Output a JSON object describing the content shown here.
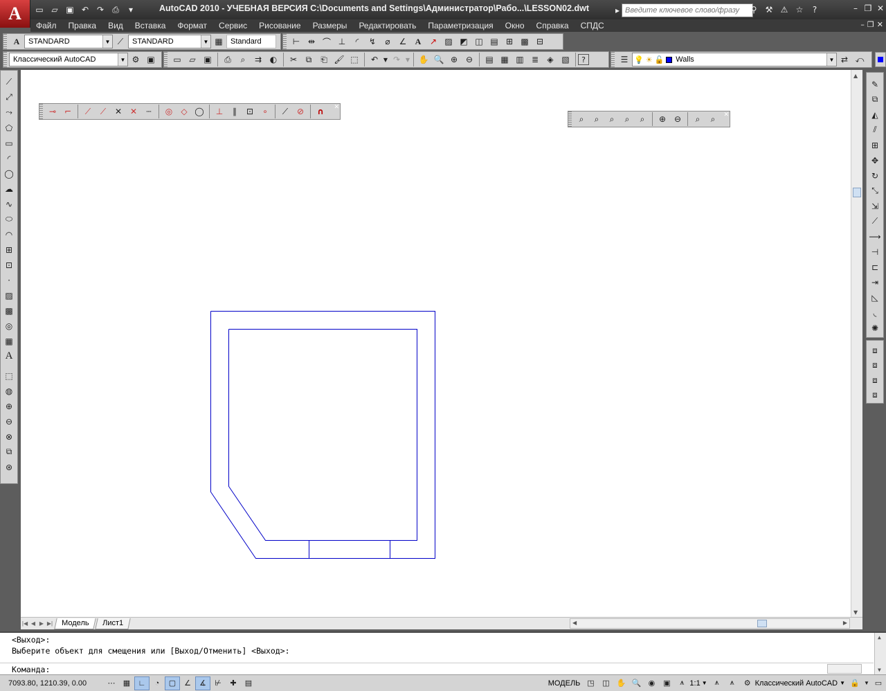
{
  "window": {
    "title": "AutoCAD 2010 - УЧЕБНАЯ ВЕРСИЯ    C:\\Documents and Settings\\Администратор\\Рабо...\\LESSON02.dwt",
    "search_placeholder": "Введите ключевое слово/фразу"
  },
  "menu": [
    "Файл",
    "Правка",
    "Вид",
    "Вставка",
    "Формат",
    "Сервис",
    "Рисование",
    "Размеры",
    "Редактировать",
    "Параметризация",
    "Окно",
    "Справка",
    "СПДС"
  ],
  "styles_toolbar": {
    "text_style": "STANDARD",
    "dim_style": "STANDARD",
    "table_style": "Standard"
  },
  "workspace_toolbar": {
    "workspace": "Классический AutoCAD",
    "layer": "Walls",
    "layer_color": "#0000ff"
  },
  "layout_tabs": [
    "Модель",
    "Лист1"
  ],
  "command_line": {
    "history": [
      "<Выход>:",
      "Выберите объект для смещения или [Выход/Отменить] <Выход>:"
    ],
    "prompt": "Команда:"
  },
  "status_bar": {
    "coordinates": "7093.80, 1210.39, 0.00",
    "space_label": "МОДЕЛЬ",
    "annotation_scale": "1:1",
    "workspace": "Классический AutoCAD"
  },
  "drawing": {
    "line_color": "#0000c8"
  }
}
